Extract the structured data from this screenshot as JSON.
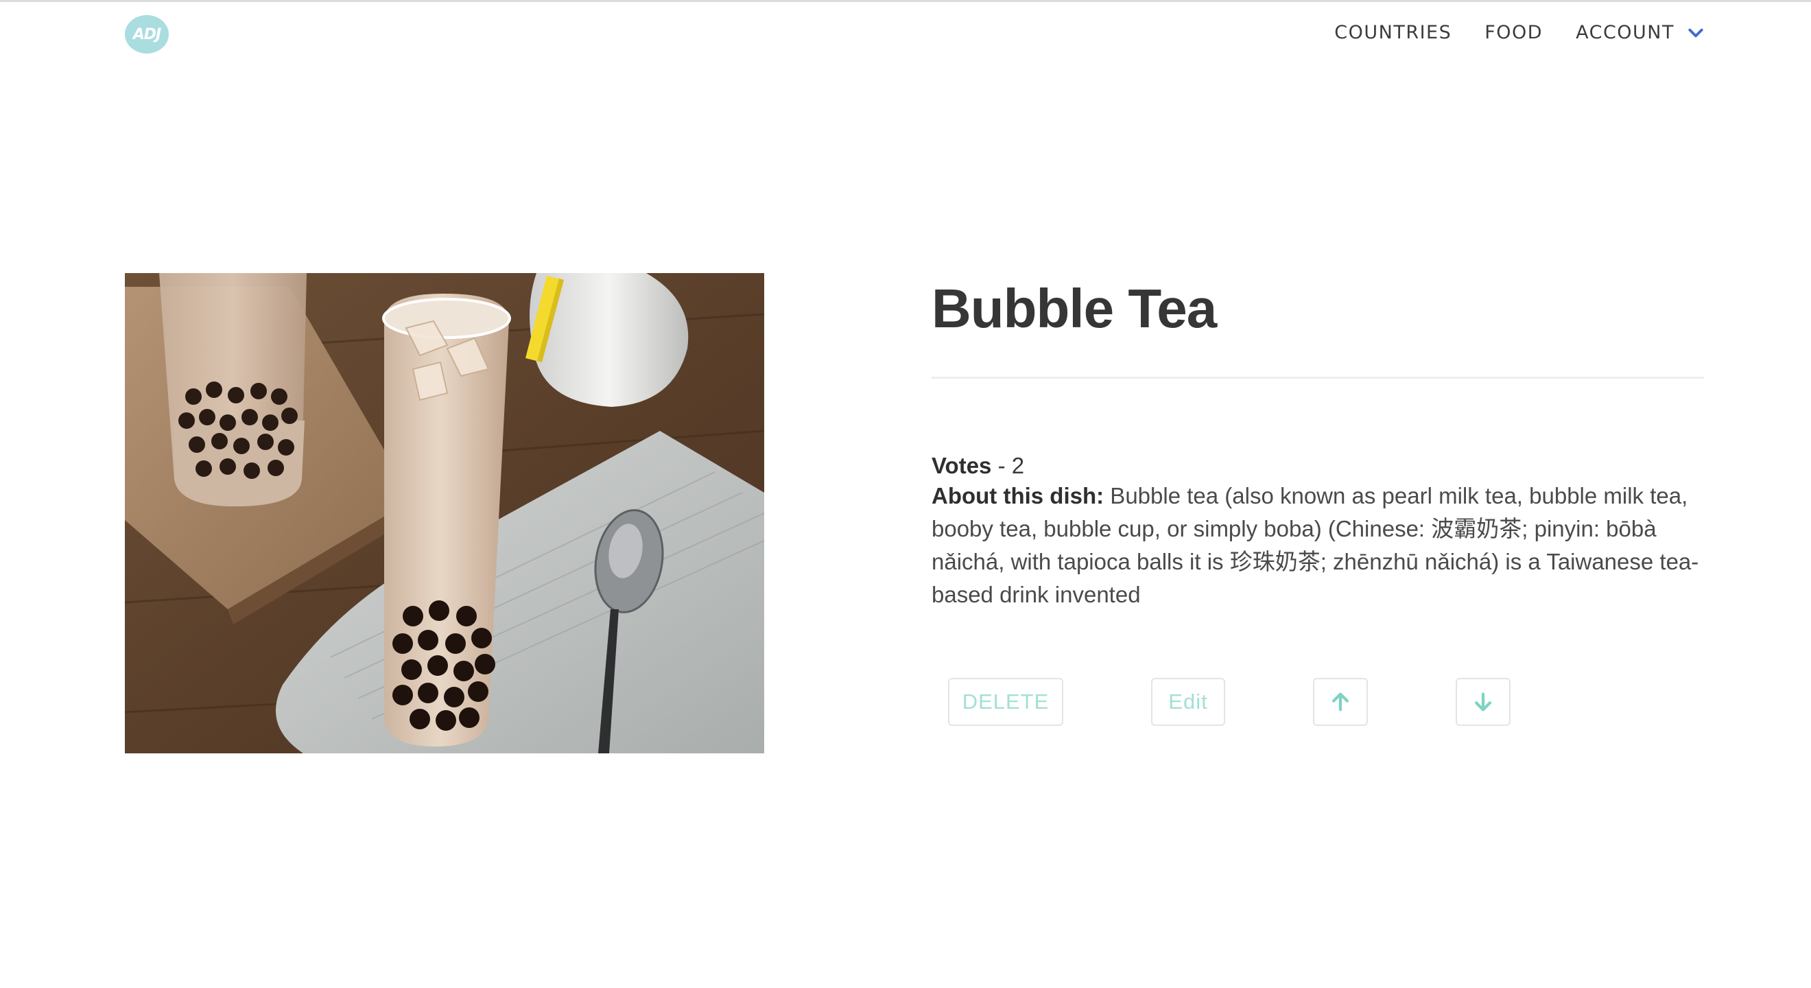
{
  "nav": {
    "logo_text": "ADJ",
    "items": [
      {
        "label": "COUNTRIES"
      },
      {
        "label": "FOOD"
      },
      {
        "label": "ACCOUNT"
      }
    ],
    "account_icon": "chevron-down-icon"
  },
  "dish": {
    "image_alt": "Bubble tea photo",
    "title": "Bubble Tea",
    "votes_label": "Votes",
    "votes_separator": " - ",
    "votes_value": "2",
    "about_label": "About this dish:",
    "about_text": " Bubble tea (also known as pearl milk tea, bubble milk tea, booby tea, bubble cup, or simply boba) (Chinese: 波霸奶茶; pinyin: bōbà nǎichá, with tapioca balls it is 珍珠奶茶; zhēnzhū nǎichá) is a Taiwanese tea-based drink invented"
  },
  "actions": {
    "delete_label": "DELETE",
    "edit_label": "Edit",
    "upvote_icon": "arrow-up-icon",
    "downvote_icon": "arrow-down-icon"
  },
  "colors": {
    "accent": "#a3e0d4",
    "logo_bg": "#a9dde0",
    "chevron": "#3f6fc6",
    "title": "#363636"
  }
}
